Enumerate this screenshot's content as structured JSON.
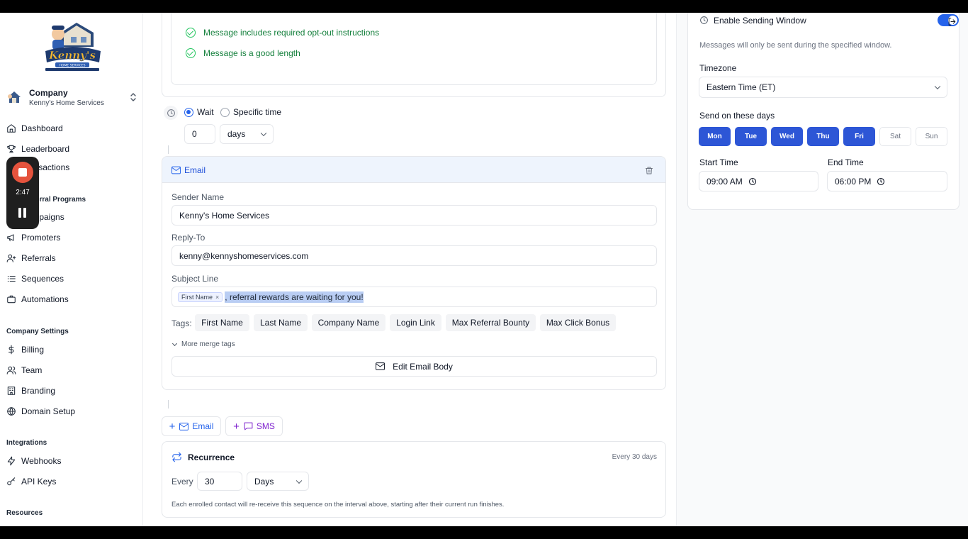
{
  "sidebar": {
    "company_label": "Company",
    "company_name": "Kenny's Home Services",
    "items": [
      {
        "label": "Dashboard"
      },
      {
        "label": "Leaderboard"
      },
      {
        "label": "Transactions"
      },
      {
        "label": "Campaigns"
      },
      {
        "label": "Promoters"
      },
      {
        "label": "Referrals"
      },
      {
        "label": "Sequences"
      },
      {
        "label": "Automations"
      },
      {
        "label": "Billing"
      },
      {
        "label": "Team"
      },
      {
        "label": "Branding"
      },
      {
        "label": "Domain Setup"
      },
      {
        "label": "Webhooks"
      },
      {
        "label": "API Keys"
      }
    ],
    "sections": {
      "programs": "Your Referral Programs",
      "company_settings": "Company Settings",
      "integrations": "Integrations",
      "resources": "Resources"
    }
  },
  "recorder": {
    "time": "2:47"
  },
  "checks": [
    "Message includes required opt-out instructions",
    "Message is a good length"
  ],
  "delay": {
    "wait_label": "Wait",
    "specific_label": "Specific time",
    "amount": "0",
    "unit": "days"
  },
  "email_step": {
    "title": "Email",
    "sender_label": "Sender Name",
    "sender_value": "Kenny's Home Services",
    "reply_label": "Reply-To",
    "reply_value": "kenny@kennyshomeservices.com",
    "subject_label": "Subject Line",
    "subject_chip": "First Name",
    "subject_text": ", referral rewards are waiting for you!",
    "tags_label": "Tags:",
    "tags": [
      "First Name",
      "Last Name",
      "Company Name",
      "Login Link",
      "Max Referral Bounty",
      "Max Click Bonus"
    ],
    "more_tags": "More merge tags",
    "edit_body": "Edit Email Body"
  },
  "add_buttons": {
    "email": "Email",
    "sms": "SMS"
  },
  "recurrence": {
    "title": "Recurrence",
    "summary": "Every 30 days",
    "every_label": "Every",
    "every_value": "30",
    "unit": "Days",
    "note": "Each enrolled contact will re-receive this sequence on the interval above, starting after their current run finishes."
  },
  "sending_window": {
    "title": "Enable Sending Window",
    "enabled": true,
    "description": "Messages will only be sent during the specified window.",
    "timezone_label": "Timezone",
    "timezone_value": "Eastern Time (ET)",
    "days_label": "Send on these days",
    "days": [
      {
        "label": "Mon",
        "on": true
      },
      {
        "label": "Tue",
        "on": true
      },
      {
        "label": "Wed",
        "on": true
      },
      {
        "label": "Thu",
        "on": true
      },
      {
        "label": "Fri",
        "on": true
      },
      {
        "label": "Sat",
        "on": false
      },
      {
        "label": "Sun",
        "on": false
      }
    ],
    "start_label": "Start Time",
    "start_value": "09:00 AM",
    "end_label": "End Time",
    "end_value": "06:00 PM"
  },
  "colors": {
    "accent": "#2d56d6",
    "success": "#15803d",
    "sms": "#7e22ce",
    "recorder_stop": "#e5533d"
  }
}
